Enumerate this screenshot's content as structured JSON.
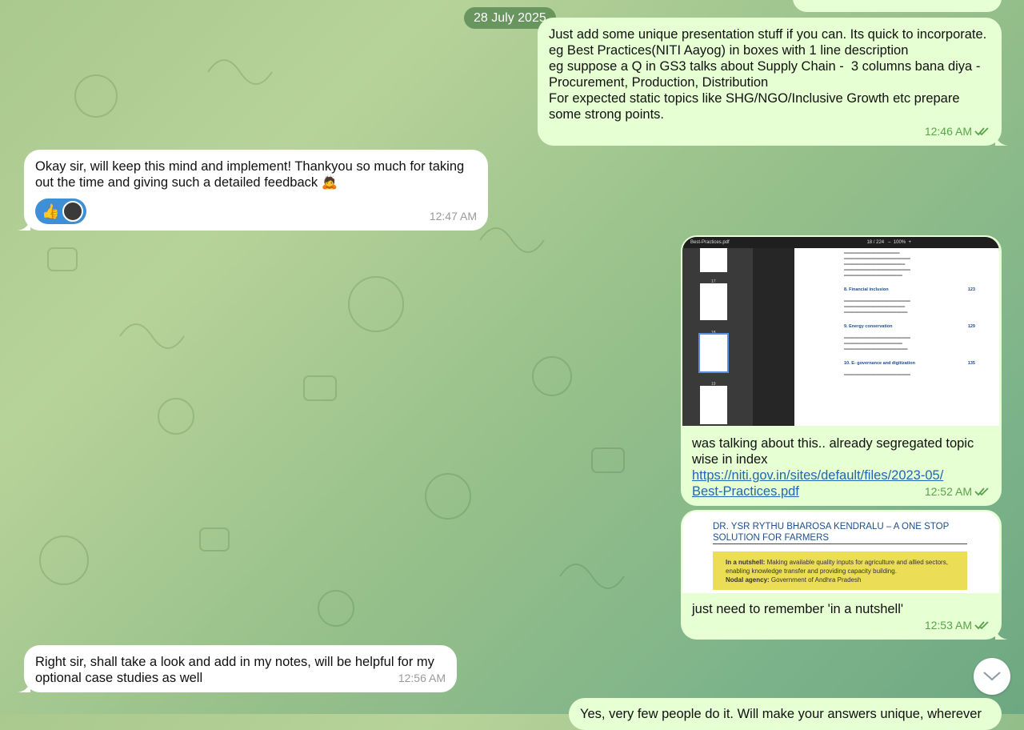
{
  "date_separator": "28 July 2025",
  "messages": [
    {
      "id": "m1",
      "text": "Just add some unique presentation stuff if you can. Its quick to incorporate.\neg Best Practices(NITI Aayog) in boxes with 1 line description\neg suppose a Q in GS3 talks about Supply Chain -  3 columns bana diya - Procurement, Production, Distribution\nFor expected static topics like SHG/NGO/Inclusive Growth etc prepare some strong points.",
      "time": "12:46 AM"
    },
    {
      "id": "m2",
      "text": "Okay sir, will keep this mind and implement! Thankyou so much for taking out the time and giving such a detailed feedback 🙇",
      "time": "12:47 AM",
      "reaction": "👍"
    },
    {
      "id": "m3",
      "text": "was talking about this.. already segregated topic wise in index",
      "link": "https://niti.gov.in/sites/default/files/2023-05/Best-Practices.pdf",
      "link_line1": "https://niti.gov.in/sites/default/files/2023-05/",
      "link_line2": "Best-Practices.pdf",
      "time": "12:52 AM",
      "pdf": {
        "filename": "Best-Practices.pdf",
        "page": "18 / 224",
        "zoom": "100%",
        "thumb_labels": [
          "17",
          "18",
          "19"
        ],
        "sections": [
          {
            "num": "8.",
            "title": "Financial inclusion",
            "page": "123"
          },
          {
            "num": "9.",
            "title": "Energy conservation",
            "page": "129"
          },
          {
            "num": "10.",
            "title": "E- governance and digitization",
            "page": "135"
          }
        ]
      }
    },
    {
      "id": "m4",
      "text": "just need to remember 'in a nutshell'",
      "time": "12:53 AM",
      "doc": {
        "title": "DR. YSR RYTHU BHAROSA KENDRALU – A ONE STOP SOLUTION FOR FARMERS",
        "nutshell_label": "In a nutshell:",
        "nutshell_text": "Making available quality inputs for agriculture and allied sectors, enabling knowledge transfer and providing capacity building.",
        "agency_label": "Nodal agency:",
        "agency_text": "Government of Andhra Pradesh"
      }
    },
    {
      "id": "m5",
      "text": "Right sir, shall take a look and add in my notes, will be helpful for my optional case studies as well",
      "time": "12:56 AM"
    },
    {
      "id": "m6",
      "text": "Yes, very few people do it. Will make your answers unique, wherever"
    }
  ],
  "colors": {
    "outgoing_bubble": "#e6ffd3",
    "incoming_bubble": "#ffffff",
    "check_color": "#5aa24a",
    "link_color": "#1f67b3"
  }
}
